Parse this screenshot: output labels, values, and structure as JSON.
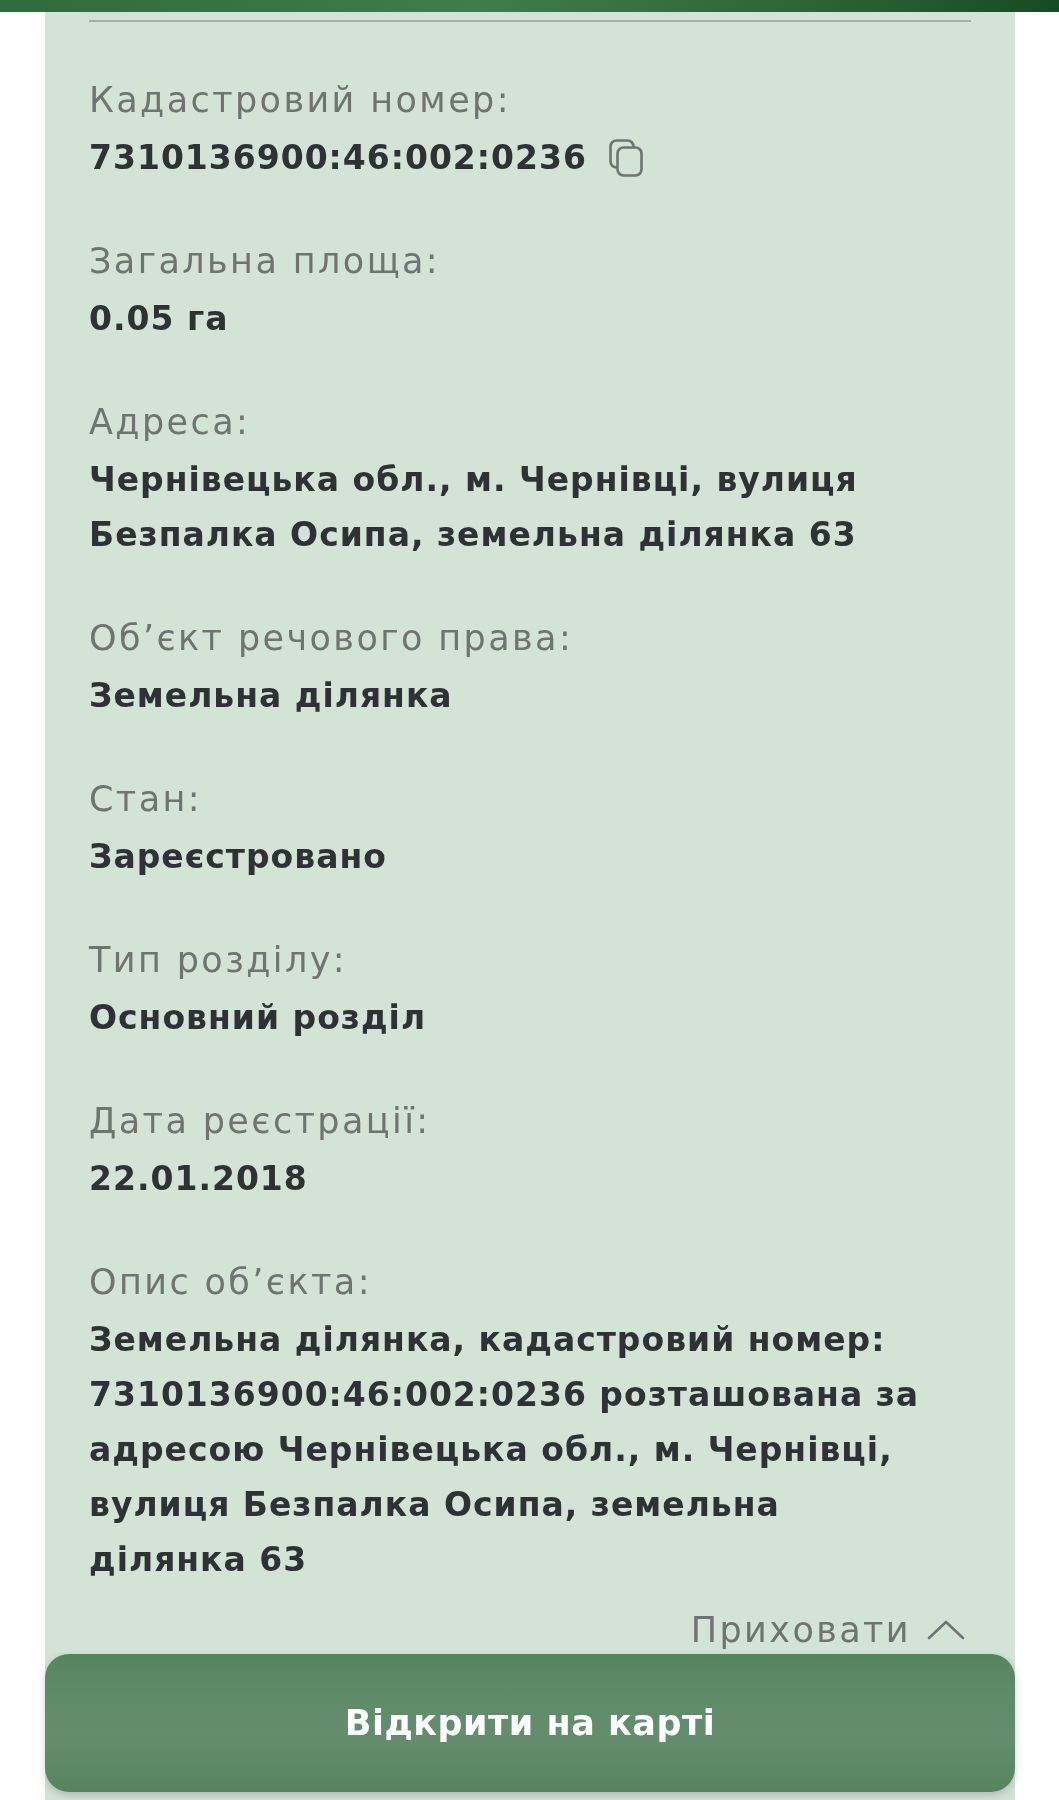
{
  "fields": [
    {
      "label": "Кадастровий номер:",
      "value": "7310136900:46:002:0236",
      "kind": "copyable"
    },
    {
      "label": "Загальна площа:",
      "value": "0.05 га",
      "kind": "text"
    },
    {
      "label": "Адреса:",
      "value": "Чернівецька обл., м. Чернівці, вулиця Безпалка Осипа, земельна ділянка 63",
      "kind": "text"
    },
    {
      "label": "Об’єкт речового права:",
      "value": "Земельна ділянка",
      "kind": "text"
    },
    {
      "label": "Стан:",
      "value": "Зареєстровано",
      "kind": "text"
    },
    {
      "label": "Тип розділу:",
      "value": "Основний розділ",
      "kind": "text"
    },
    {
      "label": "Дата реєстрації:",
      "value": "22.01.2018",
      "kind": "text"
    },
    {
      "label": "Опис об’єкта:",
      "value": "Земельна ділянка, кадастровий номер: 7310136900:46:002:0236 розташована за адресою Чернівецька обл., м. Чернівці, вулиця Безпалка Осипа, земельна ділянка 63",
      "kind": "text"
    }
  ],
  "collapse_link": {
    "label": "Приховати",
    "expanded": true
  },
  "map_button": {
    "label": "Відкрити на карті"
  }
}
